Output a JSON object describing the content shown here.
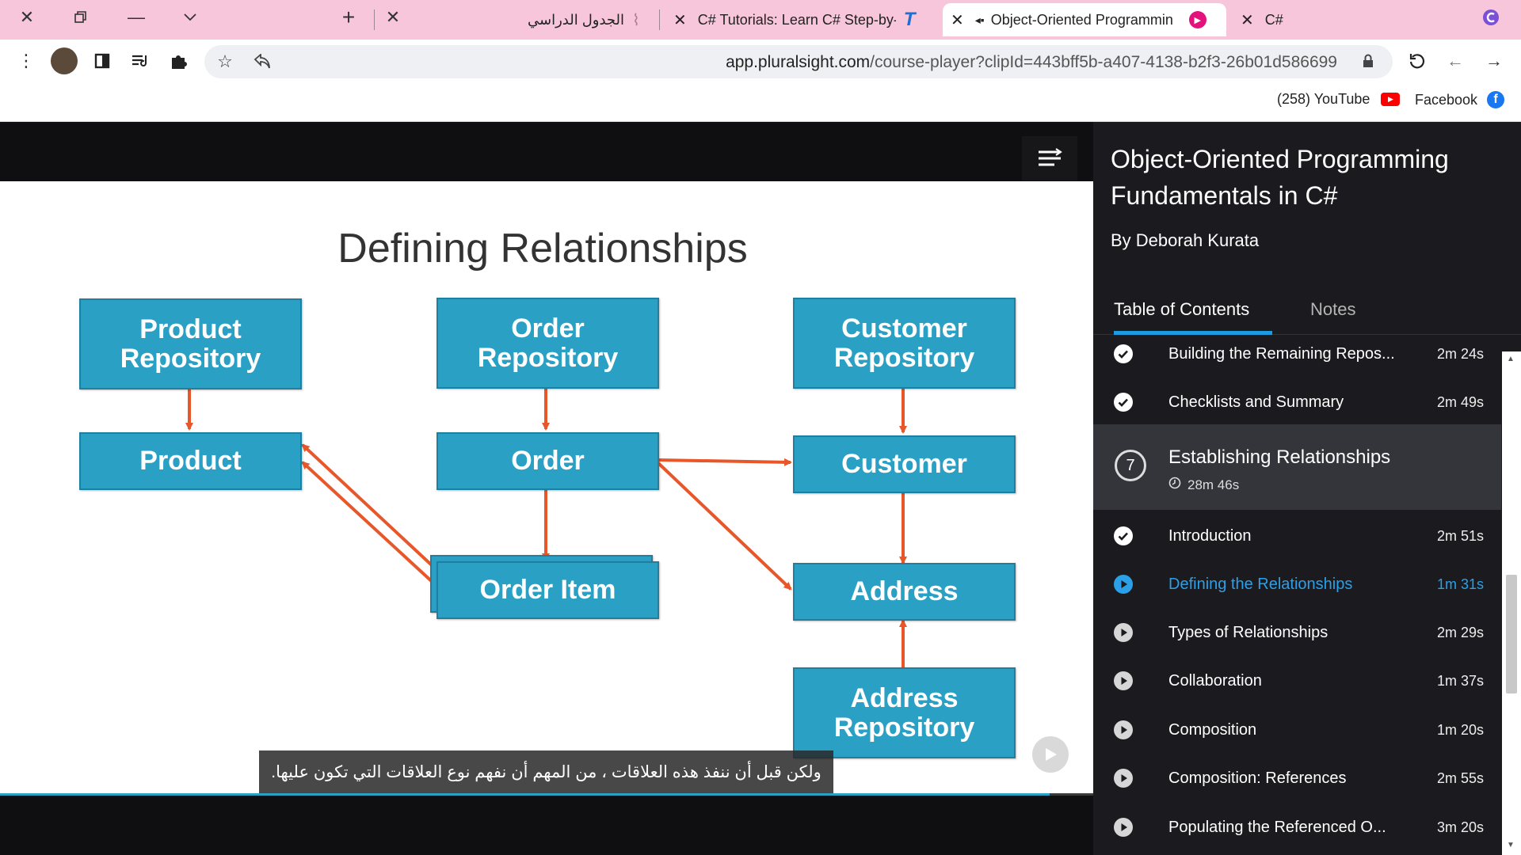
{
  "browser": {
    "tabs": [
      {
        "title": "الجدول الدراسي",
        "active": false
      },
      {
        "title": "C# Tutorials: Learn C# Step-by-St",
        "active": false
      },
      {
        "title": "Object-Oriented Programmin",
        "active": true
      },
      {
        "title": "C#",
        "active": false
      }
    ],
    "url_host": "app.pluralsight.com",
    "url_path": "/course-player?clipId=443bff5b-a407-4138-b2f3-26b01d586699",
    "bookmarks": [
      {
        "label": "(258) YouTube"
      },
      {
        "label": "Facebook"
      }
    ]
  },
  "slide": {
    "title": "Defining Relationships",
    "boxes": {
      "product_repo": "Product Repository",
      "order_repo": "Order Repository",
      "customer_repo": "Customer Repository",
      "product": "Product",
      "order": "Order",
      "customer": "Customer",
      "order_item": "Order Item",
      "address": "Address",
      "address_repo": "Address Repository"
    },
    "caption": "ولكن قبل أن ننفذ هذه العلاقات ، من المهم أن نفهم نوع العلاقات التي تكون عليها.",
    "progress_fraction": 0.96
  },
  "sidebar": {
    "course_title": "Object-Oriented Programming Fundamentals in C#",
    "author": "By Deborah Kurata",
    "tab_toc": "Table of Contents",
    "tab_notes": "Notes",
    "module": {
      "number": "7",
      "title": "Establishing Relationships",
      "duration": "28m 46s"
    },
    "clips_before": [
      {
        "title": "Building the Remaining Repos...",
        "duration": "2m 24s",
        "status": "done"
      },
      {
        "title": "Checklists and Summary",
        "duration": "2m 49s",
        "status": "done"
      }
    ],
    "clips": [
      {
        "title": "Introduction",
        "duration": "2m 51s",
        "status": "done"
      },
      {
        "title": "Defining the Relationships",
        "duration": "1m 31s",
        "status": "current"
      },
      {
        "title": "Types of Relationships",
        "duration": "2m 29s",
        "status": "todo"
      },
      {
        "title": "Collaboration",
        "duration": "1m 37s",
        "status": "todo"
      },
      {
        "title": "Composition",
        "duration": "1m 20s",
        "status": "todo"
      },
      {
        "title": "Composition: References",
        "duration": "2m 55s",
        "status": "todo"
      },
      {
        "title": "Populating the Referenced O...",
        "duration": "3m 20s",
        "status": "todo"
      }
    ]
  },
  "colors": {
    "accent": "#2ba0e8",
    "box": "#2ba0c5",
    "arrow": "#e8572a",
    "tabstrip": "#f7c6da"
  }
}
